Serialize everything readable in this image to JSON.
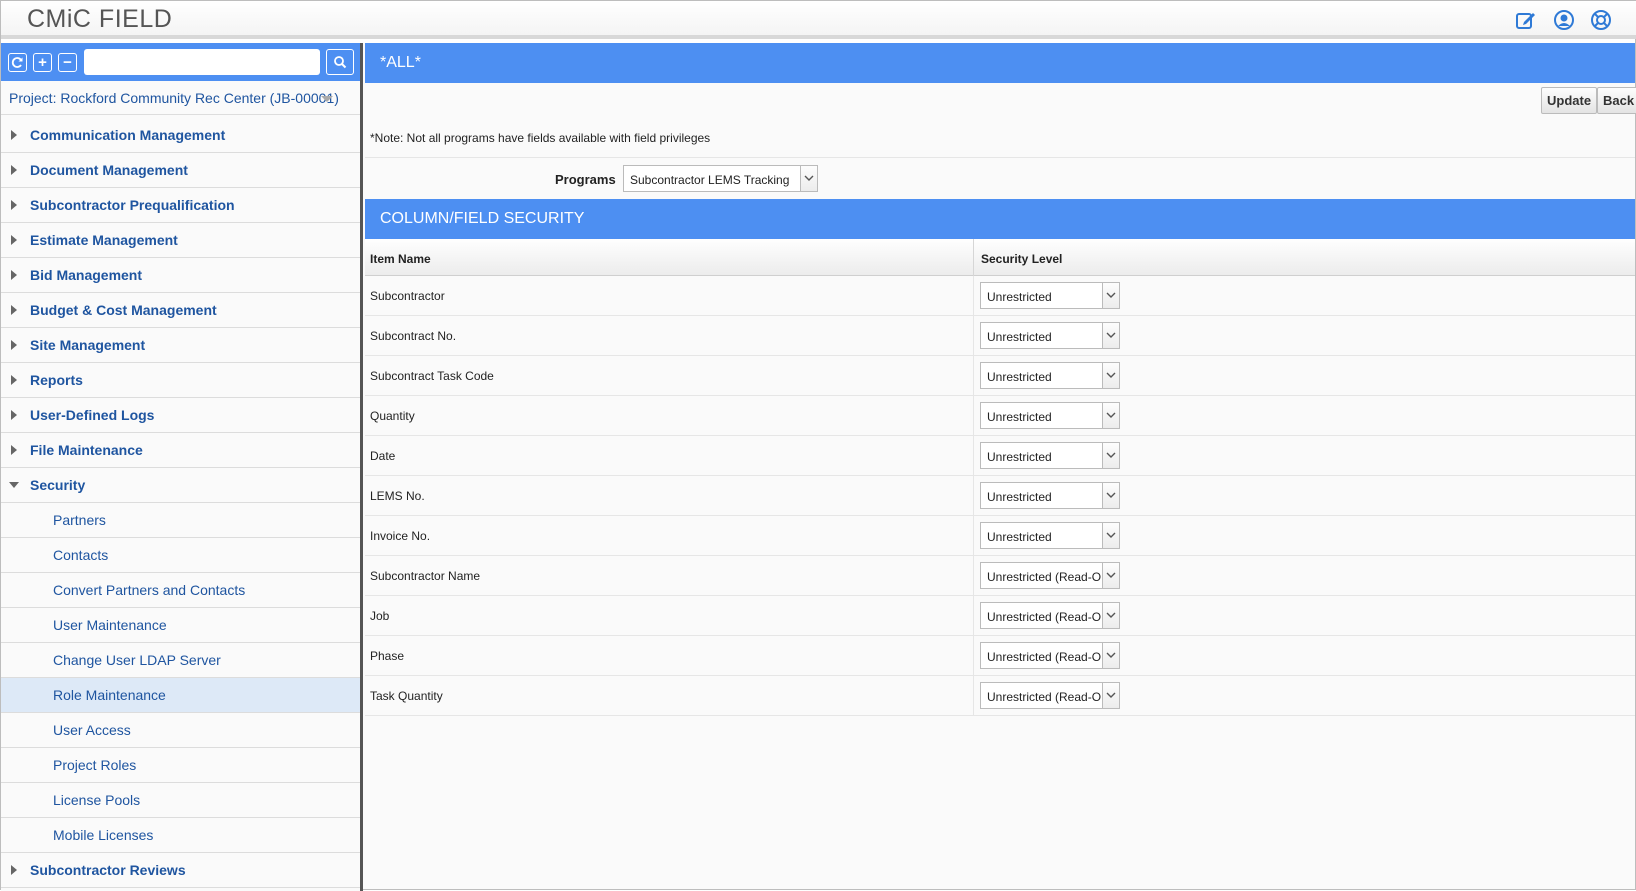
{
  "app": {
    "title": "CMiC FIELD",
    "header_icons": [
      "edit-icon",
      "user-icon",
      "help-icon"
    ],
    "accent_color": "#4d8ff2"
  },
  "sidebar": {
    "toolbar": {
      "refresh": "refresh-icon",
      "expand": "+",
      "collapse": "−",
      "search_value": "",
      "search_icon": "search-icon"
    },
    "project": "Project: Rockford Community Rec Center (JB-00001)",
    "items": [
      {
        "label": "Communication Management",
        "level": 0,
        "expanded": false
      },
      {
        "label": "Document Management",
        "level": 0,
        "expanded": false
      },
      {
        "label": "Subcontractor Prequalification",
        "level": 0,
        "expanded": false
      },
      {
        "label": "Estimate Management",
        "level": 0,
        "expanded": false
      },
      {
        "label": "Bid Management",
        "level": 0,
        "expanded": false
      },
      {
        "label": "Budget & Cost Management",
        "level": 0,
        "expanded": false
      },
      {
        "label": "Site Management",
        "level": 0,
        "expanded": false
      },
      {
        "label": "Reports",
        "level": 0,
        "expanded": false
      },
      {
        "label": "User-Defined Logs",
        "level": 0,
        "expanded": false
      },
      {
        "label": "File Maintenance",
        "level": 0,
        "expanded": false
      },
      {
        "label": "Security",
        "level": 0,
        "expanded": true
      },
      {
        "label": "Partners",
        "level": 1
      },
      {
        "label": "Contacts",
        "level": 1
      },
      {
        "label": "Convert Partners and Contacts",
        "level": 1
      },
      {
        "label": "User Maintenance",
        "level": 1
      },
      {
        "label": "Change User LDAP Server",
        "level": 1
      },
      {
        "label": "Role Maintenance",
        "level": 1,
        "selected": true
      },
      {
        "label": "User Access",
        "level": 1
      },
      {
        "label": "Project Roles",
        "level": 1
      },
      {
        "label": "License Pools",
        "level": 1
      },
      {
        "label": "Mobile Licenses",
        "level": 1
      },
      {
        "label": "Subcontractor Reviews",
        "level": 0,
        "expanded": false
      }
    ]
  },
  "main": {
    "title": "*ALL*",
    "buttons": {
      "update": "Update",
      "back": "Back"
    },
    "note": "*Note: Not all programs have fields available with field privileges",
    "programs": {
      "label": "Programs",
      "value": "Subcontractor LEMS Tracking"
    },
    "section_title": "COLUMN/FIELD SECURITY",
    "table": {
      "headers": [
        "Item Name",
        "Security Level"
      ],
      "rows": [
        {
          "name": "Subcontractor",
          "level": "Unrestricted"
        },
        {
          "name": "Subcontract No.",
          "level": "Unrestricted"
        },
        {
          "name": "Subcontract Task Code",
          "level": "Unrestricted"
        },
        {
          "name": "Quantity",
          "level": "Unrestricted"
        },
        {
          "name": "Date",
          "level": "Unrestricted"
        },
        {
          "name": "LEMS No.",
          "level": "Unrestricted"
        },
        {
          "name": "Invoice No.",
          "level": "Unrestricted"
        },
        {
          "name": "Subcontractor Name",
          "level": "Unrestricted (Read-O"
        },
        {
          "name": "Job",
          "level": "Unrestricted (Read-O"
        },
        {
          "name": "Phase",
          "level": "Unrestricted (Read-O"
        },
        {
          "name": "Task Quantity",
          "level": "Unrestricted (Read-O"
        }
      ]
    }
  }
}
